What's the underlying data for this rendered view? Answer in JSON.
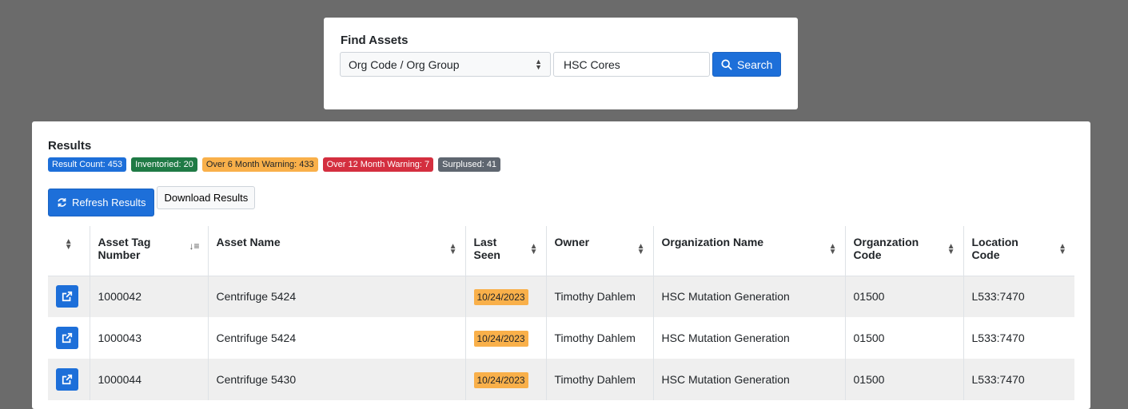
{
  "find": {
    "title": "Find Assets",
    "select_value": "Org Code / Org Group",
    "search_value": "HSC Cores",
    "search_button": "Search"
  },
  "results": {
    "title": "Results",
    "badges": {
      "count": "Result Count: 453",
      "inventoried": "Inventoried: 20",
      "six_month": "Over 6 Month Warning: 433",
      "twelve_month": "Over 12 Month Warning: 7",
      "surplused": "Surplused: 41"
    },
    "refresh_button": "Refresh Results",
    "download_button": "Download Results",
    "columns": {
      "asset_tag_line1": "Asset Tag",
      "asset_tag_line2": "Number",
      "asset_name": "Asset Name",
      "last_seen_line1": "Last",
      "last_seen_line2": "Seen",
      "owner": "Owner",
      "org_name": "Organization Name",
      "org_code_line1": "Organzation",
      "org_code_line2": "Code",
      "location_line1": "Location",
      "location_line2": "Code"
    },
    "rows": [
      {
        "tag": "1000042",
        "name": "Centrifuge 5424",
        "last_seen": "10/24/2023",
        "owner": "Timothy Dahlem",
        "org_name": "HSC Mutation Generation",
        "org_code": "01500",
        "location": "L533:7470"
      },
      {
        "tag": "1000043",
        "name": "Centrifuge 5424",
        "last_seen": "10/24/2023",
        "owner": "Timothy Dahlem",
        "org_name": "HSC Mutation Generation",
        "org_code": "01500",
        "location": "L533:7470"
      },
      {
        "tag": "1000044",
        "name": "Centrifuge 5430",
        "last_seen": "10/24/2023",
        "owner": "Timothy Dahlem",
        "org_name": "HSC Mutation Generation",
        "org_code": "01500",
        "location": "L533:7470"
      }
    ]
  },
  "colors": {
    "primary": "#1d6fd9",
    "success": "#1f7a45",
    "warning": "#f9b04a",
    "danger": "#d42f3f",
    "secondary": "#5f6670",
    "backdrop": "#6b6b6b"
  }
}
